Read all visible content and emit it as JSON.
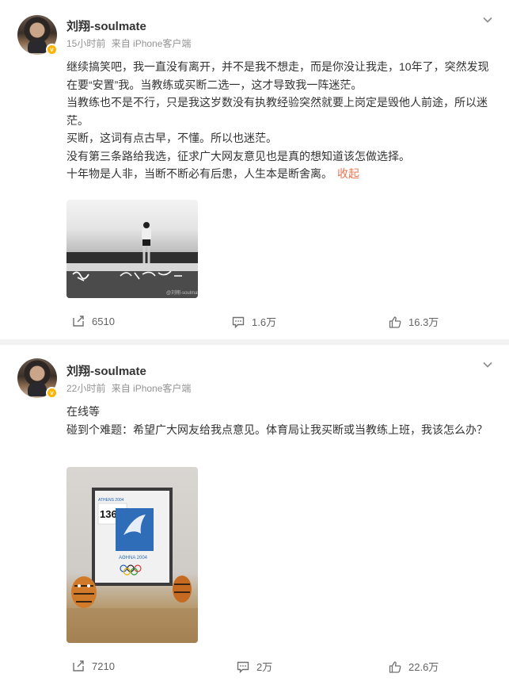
{
  "posts": [
    {
      "author": "刘翔-soulmate",
      "time": "15小时前",
      "source": "来自 iPhone客户端",
      "paragraphs": [
        "继续搞笑吧，我一直没有离开，并不是我不想走，而是你没让我走，10年了，突然发现在要“安置”我。当教练或买断二选一，这才导致我一阵迷茫。",
        "当教练也不是不行，只是我这岁数没有执教经验突然就要上岗定是毁他人前途，所以迷茫。",
        "买断，这词有点古早，不懂。所以也迷茫。",
        "没有第三条路给我选，征求广大网友意见也是真的想知道该怎做选择。",
        "十年物是人非，当断不断必有后患，人生本是断舍离。"
      ],
      "collapse_label": "收起",
      "photo_text": "@刘翔-soulmate",
      "repost_count": "6510",
      "comment_count": "1.6万",
      "like_count": "16.3万"
    },
    {
      "author": "刘翔-soulmate",
      "time": "22小时前",
      "source": "来自 iPhone客户端",
      "paragraphs": [
        "在线等",
        "碰到个难题：希望广大网友给我点意见。体育局让我买断或当教练上班，我该怎么办？"
      ],
      "photo_text": "ATHENS 2004",
      "photo_bib": "1363",
      "photo_caption": "AΘHNA 2004",
      "repost_count": "7210",
      "comment_count": "2万",
      "like_count": "22.6万"
    }
  ],
  "colors": {
    "accent": "#eb7350",
    "badge": "#ffb300",
    "meta": "#939393"
  },
  "icons": [
    "chevron-down-icon",
    "repost-icon",
    "comment-icon",
    "like-icon",
    "verified-badge-icon"
  ]
}
